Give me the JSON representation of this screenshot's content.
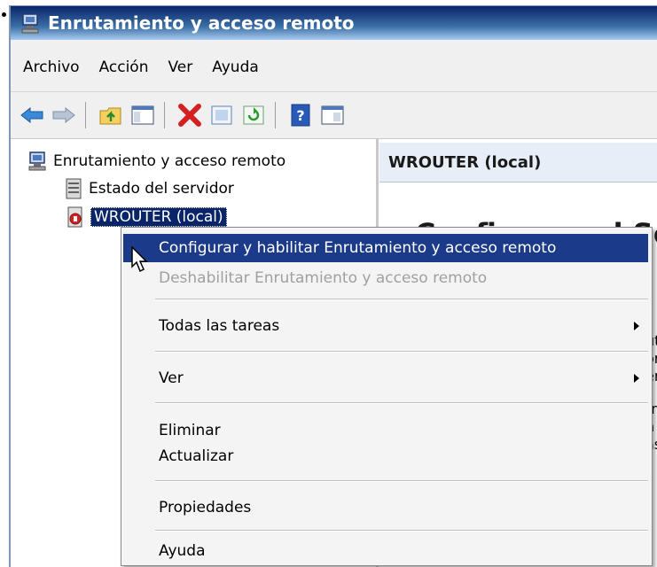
{
  "window": {
    "title": "Enrutamiento y acceso remoto"
  },
  "menu": [
    "Archivo",
    "Acción",
    "Ver",
    "Ayuda"
  ],
  "toolbar_icons": [
    "back-arrow-icon",
    "forward-arrow-icon",
    "up-folder-icon",
    "show-hide-tree-icon",
    "delete-icon",
    "properties-icon",
    "refresh-icon",
    "help-icon",
    "mmc-console-icon"
  ],
  "tree": {
    "root": "Enrutamiento y acceso remoto",
    "status": "Estado del servidor",
    "server": "WROUTER (local)"
  },
  "right_pane": {
    "header": "WROUTER (local)",
    "heading_partial": "Configurar el Serv",
    "text_fragments": [
      "ut",
      "or",
      "er",
      "rn",
      "n",
      "as"
    ]
  },
  "context_menu": {
    "items": [
      "Configurar y habilitar Enrutamiento y acceso remoto",
      "Deshabilitar Enrutamiento y acceso remoto",
      "Todas las tareas",
      "Ver",
      "Eliminar",
      "Actualizar",
      "Propiedades",
      "Ayuda"
    ]
  },
  "colors": {
    "title_bar": "#0a246a",
    "highlight": "#1c3a8a",
    "disabled_text": "#a0a0a0"
  }
}
